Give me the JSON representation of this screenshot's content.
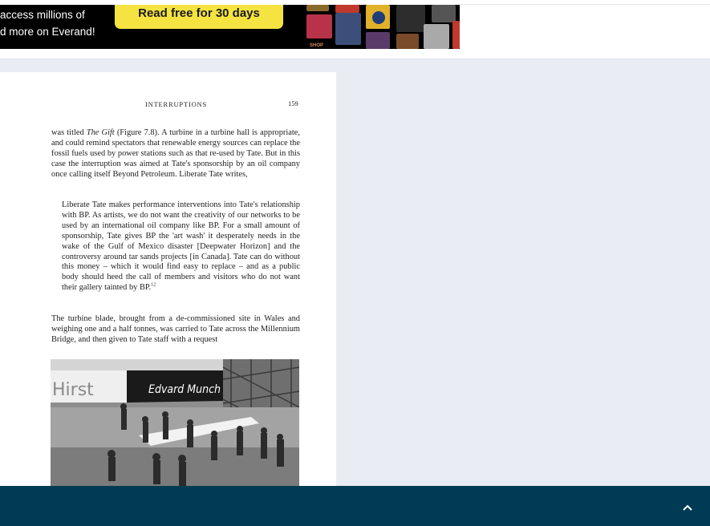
{
  "promo": {
    "line1": "access millions of",
    "line2": "d more on Everand!",
    "cta_label": "Read free for 30 days",
    "shelf_label": "SHOP"
  },
  "document": {
    "running_head": "INTERRUPTIONS",
    "page_number": "159",
    "paragraph1_prefix": "was titled ",
    "paragraph1_title": "The Gift",
    "paragraph1_rest": " (Figure 7.8). A turbine in a turbine hall is appropriate, and could remind spectators that renewable energy sources can replace the fossil fuels used by power stations such as that re-used by Tate. But in this case the interruption was aimed at Tate's sponsorship by an oil company once calling itself Beyond Petroleum. Liberate Tate writes,",
    "quote": "Liberate Tate makes performance interventions into Tate's relationship with BP. As artists, we do not want the creativity of our networks to be used by an international oil company like BP. For a small amount of sponsorship, Tate gives BP the 'art wash' it desperately needs in the wake of the Gulf of Mexico disaster [Deepwater Horizon] and the controversy around tar sands projects [in Canada]. Tate can do without this money – which it would find easy to replace – and as a public body should heed the call of members and visitors who do not want their gallery tainted by BP.",
    "quote_footnote": "12",
    "paragraph2": "The turbine blade, brought from a de-commissioned site in Wales and weighing one and a half tonnes, was carried to Tate across the Millennium Bridge, and then given to Tate staff with a request",
    "photo_signs": {
      "left": "Hirst",
      "right": "Edvard Munch"
    }
  },
  "colors": {
    "promo_background": "#000000",
    "cta_yellow": "#f5e342",
    "bottom_bar": "#003b55",
    "viewer_background": "#e9edf3"
  },
  "icons": {
    "scroll_up": "chevron-up-icon"
  }
}
